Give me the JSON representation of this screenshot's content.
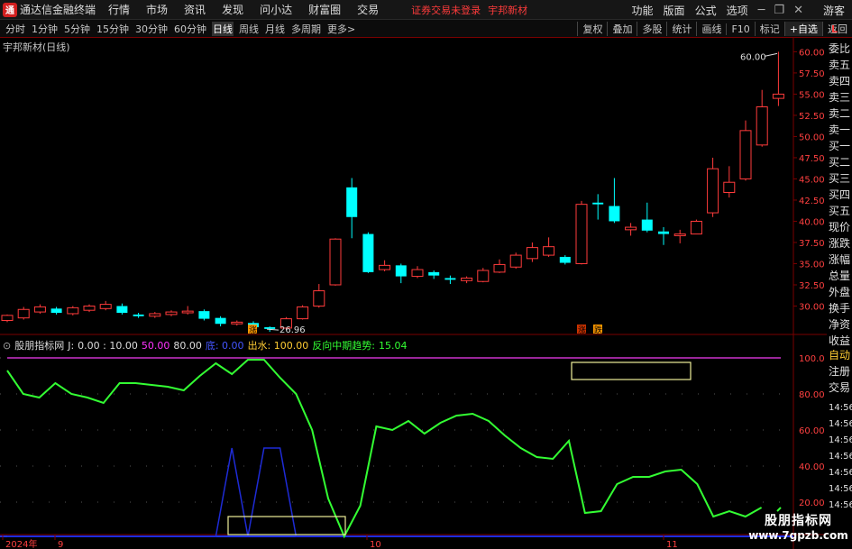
{
  "titlebar": {
    "app_title": "通达信金融终端",
    "menus": [
      "行情",
      "市场",
      "资讯",
      "发现",
      "问小达",
      "财富圈",
      "交易"
    ],
    "status_warn": "证券交易未登录",
    "stock_title": "宇邦新材",
    "right_menus": [
      "功能",
      "版面",
      "公式",
      "选项"
    ],
    "guest": "游客"
  },
  "periodbar": {
    "periods": [
      "分时",
      "1分钟",
      "5分钟",
      "15分钟",
      "30分钟",
      "60分钟",
      "日线",
      "周线",
      "月线",
      "多周期",
      "更多>"
    ],
    "active_period": "日线",
    "tools": [
      "复权",
      "叠加",
      "多股",
      "统计",
      "画线",
      "F10",
      "标记",
      "+自选",
      "返回"
    ]
  },
  "main_label": "宇邦新材(日线)",
  "price_axis": [
    "60.00",
    "57.50",
    "55.00",
    "52.50",
    "50.00",
    "47.50",
    "45.00",
    "42.50",
    "40.00",
    "37.50",
    "35.00",
    "32.50",
    "30.00"
  ],
  "annotations": {
    "high_label": "60.00",
    "low_label": "26.96",
    "marker_1": "涨",
    "marker_2": "跌"
  },
  "indicator": {
    "name": "股朋指标网",
    "j_label": "J:",
    "j_values": "0.00 : 10.00",
    "v50": "50.00",
    "v80": "80.00",
    "di": "底: 0.00",
    "chushui": "出水: 100.00",
    "trend_label": "反向中期趋势:",
    "trend_value": "15.04",
    "axis": [
      "100.0",
      "80.00",
      "60.00",
      "40.00",
      "20.00"
    ]
  },
  "time_axis": [
    "2024年",
    "9",
    "10",
    "11"
  ],
  "side_items": [
    "委比",
    "卖五",
    "卖四",
    "卖三",
    "卖二",
    "卖一",
    "买一",
    "买二",
    "买三",
    "买四",
    "买五",
    "现价",
    "涨跌",
    "涨幅",
    "总量",
    "外盘",
    "换手",
    "净资",
    "收益",
    "自动",
    "注册",
    "交易",
    "14:56",
    "14:56",
    "14:56",
    "14:56",
    "14:56",
    "14:56",
    "14:56"
  ],
  "side_L": "L",
  "watermark": {
    "line1": "股朋指标网",
    "line2": "www.7gpzb.com"
  },
  "colors": {
    "up": "#ff3b3b",
    "down": "#00ffff",
    "trend": "#33ff33",
    "blue": "#1e2bd6",
    "purple": "#ff33ff"
  },
  "chart_data": {
    "type": "candlestick",
    "title": "宇邦新材(日线)",
    "ylim": [
      27.5,
      61
    ],
    "candles": [
      {
        "o": 28.3,
        "c": 28.9,
        "h": 29.0,
        "l": 28.1
      },
      {
        "o": 28.6,
        "c": 29.6,
        "h": 29.9,
        "l": 28.4
      },
      {
        "o": 29.3,
        "c": 29.9,
        "h": 30.2,
        "l": 29.1
      },
      {
        "o": 29.7,
        "c": 29.2,
        "h": 29.9,
        "l": 29.0
      },
      {
        "o": 29.1,
        "c": 29.8,
        "h": 30.0,
        "l": 28.9
      },
      {
        "o": 29.5,
        "c": 30.0,
        "h": 30.2,
        "l": 29.3
      },
      {
        "o": 29.7,
        "c": 30.2,
        "h": 30.6,
        "l": 29.5
      },
      {
        "o": 30.0,
        "c": 29.2,
        "h": 30.3,
        "l": 29.0
      },
      {
        "o": 29.0,
        "c": 28.8,
        "h": 29.2,
        "l": 28.6
      },
      {
        "o": 28.8,
        "c": 29.1,
        "h": 29.3,
        "l": 28.6
      },
      {
        "o": 29.0,
        "c": 29.3,
        "h": 29.5,
        "l": 28.8
      },
      {
        "o": 29.2,
        "c": 29.4,
        "h": 30.0,
        "l": 29.0
      },
      {
        "o": 29.4,
        "c": 28.5,
        "h": 29.6,
        "l": 28.3
      },
      {
        "o": 28.6,
        "c": 27.9,
        "h": 28.8,
        "l": 27.6
      },
      {
        "o": 27.9,
        "c": 28.1,
        "h": 28.3,
        "l": 27.7
      },
      {
        "o": 28.0,
        "c": 27.5,
        "h": 28.2,
        "l": 27.2
      },
      {
        "o": 27.5,
        "c": 27.3,
        "h": 27.6,
        "l": 26.96
      },
      {
        "o": 27.4,
        "c": 28.5,
        "h": 28.7,
        "l": 27.2
      },
      {
        "o": 28.5,
        "c": 29.9,
        "h": 30.1,
        "l": 28.4
      },
      {
        "o": 30.0,
        "c": 31.8,
        "h": 32.6,
        "l": 29.8
      },
      {
        "o": 32.5,
        "c": 37.9,
        "h": 38.0,
        "l": 32.4
      },
      {
        "o": 44.0,
        "c": 40.5,
        "h": 45.1,
        "l": 38.0
      },
      {
        "o": 38.5,
        "c": 34.0,
        "h": 38.7,
        "l": 33.9
      },
      {
        "o": 34.3,
        "c": 34.8,
        "h": 35.4,
        "l": 34.1
      },
      {
        "o": 34.8,
        "c": 33.5,
        "h": 35.0,
        "l": 32.7
      },
      {
        "o": 33.5,
        "c": 34.3,
        "h": 34.7,
        "l": 33.3
      },
      {
        "o": 34.0,
        "c": 33.6,
        "h": 34.2,
        "l": 33.2
      },
      {
        "o": 33.3,
        "c": 33.1,
        "h": 33.6,
        "l": 32.6
      },
      {
        "o": 33.0,
        "c": 33.3,
        "h": 33.5,
        "l": 32.7
      },
      {
        "o": 32.9,
        "c": 34.2,
        "h": 34.5,
        "l": 32.8
      },
      {
        "o": 34.0,
        "c": 34.9,
        "h": 35.5,
        "l": 33.9
      },
      {
        "o": 34.6,
        "c": 36.0,
        "h": 36.3,
        "l": 34.4
      },
      {
        "o": 35.6,
        "c": 36.9,
        "h": 37.5,
        "l": 35.2
      },
      {
        "o": 36.0,
        "c": 37.0,
        "h": 38.1,
        "l": 35.8
      },
      {
        "o": 35.8,
        "c": 35.1,
        "h": 36.0,
        "l": 34.9
      },
      {
        "o": 35.0,
        "c": 42.0,
        "h": 42.4,
        "l": 34.9
      },
      {
        "o": 42.2,
        "c": 42.0,
        "h": 43.2,
        "l": 40.2
      },
      {
        "o": 41.8,
        "c": 40.0,
        "h": 45.1,
        "l": 39.8
      },
      {
        "o": 39.0,
        "c": 39.3,
        "h": 39.8,
        "l": 38.3
      },
      {
        "o": 40.2,
        "c": 38.9,
        "h": 42.2,
        "l": 38.7
      },
      {
        "o": 38.8,
        "c": 38.5,
        "h": 39.3,
        "l": 37.2
      },
      {
        "o": 38.3,
        "c": 38.5,
        "h": 39.0,
        "l": 37.4
      },
      {
        "o": 38.5,
        "c": 40.0,
        "h": 40.2,
        "l": 38.5
      },
      {
        "o": 41.0,
        "c": 46.2,
        "h": 47.5,
        "l": 40.5
      },
      {
        "o": 43.4,
        "c": 44.6,
        "h": 46.5,
        "l": 42.8
      },
      {
        "o": 45.0,
        "c": 50.7,
        "h": 51.9,
        "l": 44.8
      },
      {
        "o": 49.0,
        "c": 53.5,
        "h": 55.5,
        "l": 48.8
      },
      {
        "o": 54.5,
        "c": 55.0,
        "h": 60.0,
        "l": 53.6
      }
    ],
    "j_line": [
      93,
      80,
      78,
      86,
      80,
      78,
      75,
      86,
      86,
      85,
      84,
      82,
      90,
      97,
      91,
      99,
      99,
      89,
      80,
      60,
      22,
      1,
      18,
      62,
      60,
      65,
      58,
      64,
      68,
      69,
      65,
      57,
      50,
      45,
      44,
      54,
      14,
      15,
      30,
      34,
      34,
      37,
      38,
      30,
      12,
      15,
      12,
      17
    ],
    "blue_line": [
      1,
      1,
      1,
      1,
      1,
      1,
      1,
      1,
      1,
      1,
      1,
      1,
      1,
      1,
      50,
      1,
      50,
      50,
      1,
      1,
      1,
      1,
      1,
      1,
      1,
      1,
      1,
      1,
      1,
      1,
      1,
      1,
      1,
      1,
      1,
      1,
      1,
      1,
      1,
      1,
      1,
      1,
      1,
      1,
      1,
      1,
      1,
      1
    ],
    "indicator_ylim": [
      0,
      110
    ]
  }
}
